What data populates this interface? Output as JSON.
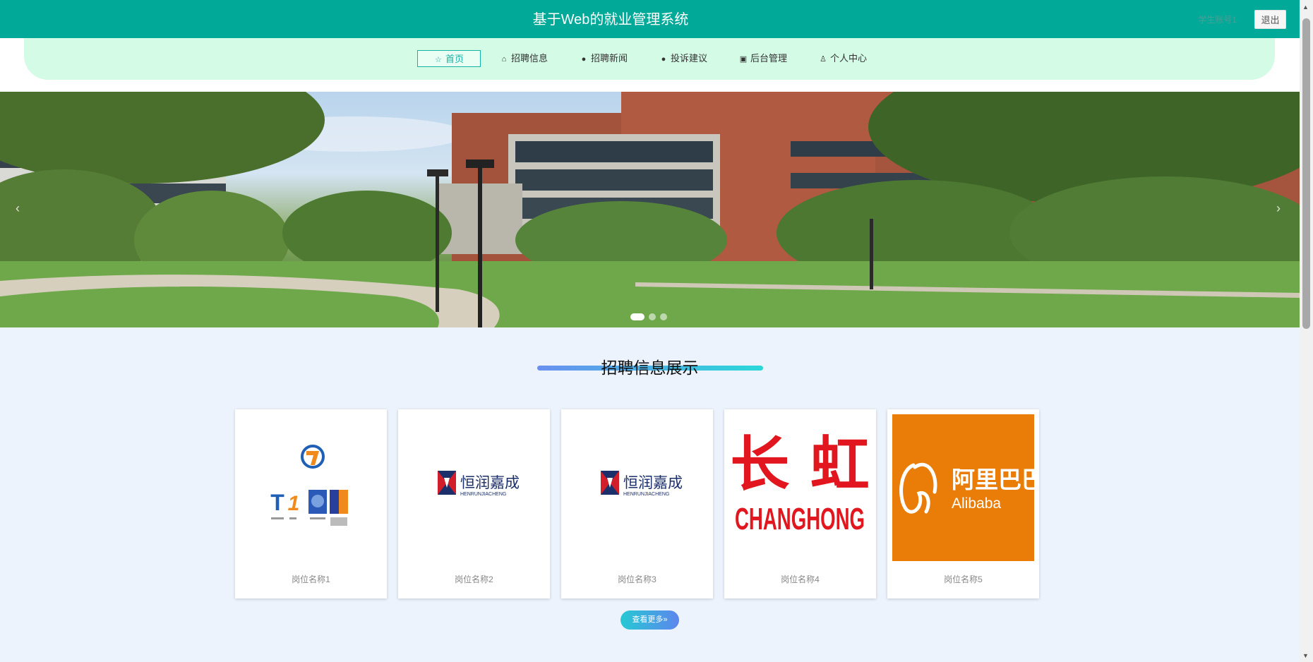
{
  "header": {
    "title": "基于Web的就业管理系统",
    "user_label": "学生账号1",
    "logout_label": "退出"
  },
  "nav": {
    "items": [
      {
        "label": "首页",
        "icon": "star-icon"
      },
      {
        "label": "招聘信息",
        "icon": "home-icon"
      },
      {
        "label": "招聘新闻",
        "icon": "info-circle-icon"
      },
      {
        "label": "投诉建议",
        "icon": "question-circle-icon"
      },
      {
        "label": "后台管理",
        "icon": "briefcase-icon"
      },
      {
        "label": "个人中心",
        "icon": "user-icon"
      }
    ]
  },
  "banner": {
    "active_slide": 1,
    "slide_count": 3
  },
  "section": {
    "title": "招聘信息展示",
    "more_label": "查看更多",
    "cards": [
      {
        "name": "岗位名称1",
        "logo": "t1-logo"
      },
      {
        "name": "岗位名称2",
        "logo": "henrunjiacheng-logo",
        "logo_text": "恒润嘉成",
        "logo_sub": "HENRUNJIACHENG"
      },
      {
        "name": "岗位名称3",
        "logo": "henrunjiacheng-logo",
        "logo_text": "恒润嘉成",
        "logo_sub": "HENRUNJIACHENG"
      },
      {
        "name": "岗位名称4",
        "logo": "changhong-logo",
        "logo_text": "长 虹",
        "logo_sub": "CHANGHONG"
      },
      {
        "name": "岗位名称5",
        "logo": "alibaba-logo",
        "logo_text": "阿里巴巴",
        "logo_sub": "Alibaba"
      }
    ]
  },
  "colors": {
    "header_bg": "#00a998",
    "nav_bg": "#d3fbe5",
    "active_accent": "#16b3a3",
    "page_bg": "#edf3fc"
  }
}
